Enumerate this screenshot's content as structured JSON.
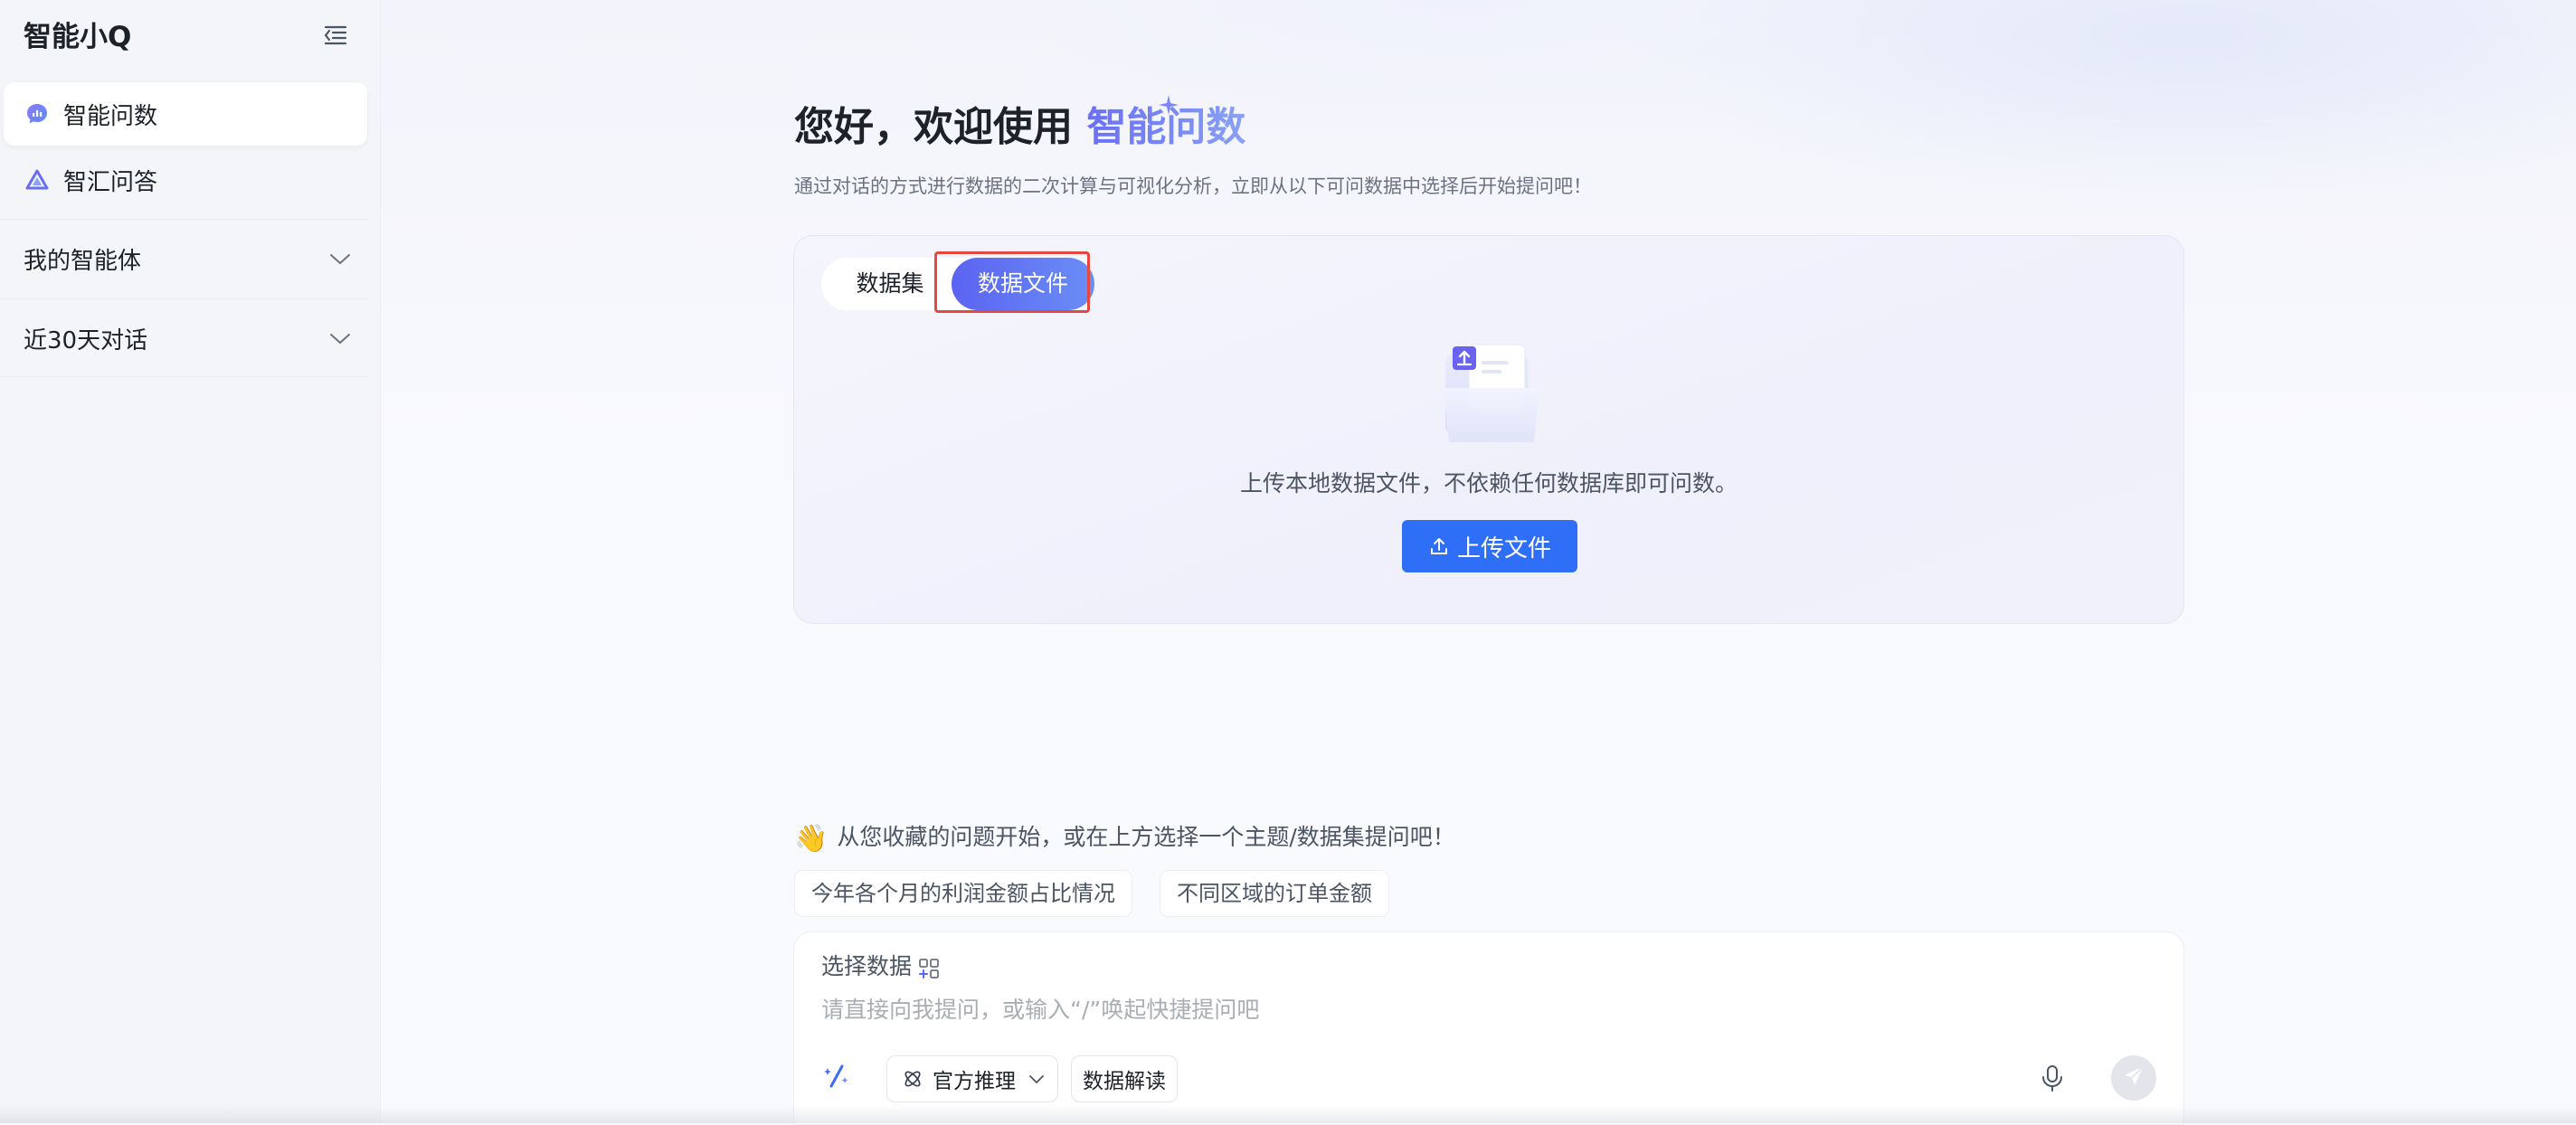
{
  "app": {
    "title": "智能小Q"
  },
  "sidebar": {
    "items": [
      {
        "label": "智能问数",
        "icon": "chat-data-icon",
        "active": true
      },
      {
        "label": "智汇问答",
        "icon": "triangle-logo-icon",
        "active": false
      }
    ],
    "sections": [
      {
        "label": "我的智能体",
        "icon": "chevron-down-icon"
      },
      {
        "label": "近30天对话",
        "icon": "chevron-down-icon"
      }
    ]
  },
  "main": {
    "greeting_prefix": "您好，欢迎使用",
    "greeting_highlight": "智能问数",
    "subtitle": "通过对话的方式进行数据的二次计算与可视化分析，立即从以下可问数据中选择后开始提问吧！",
    "tabs": [
      {
        "label": "数据集",
        "active": false
      },
      {
        "label": "数据文件",
        "active": true
      }
    ],
    "upload": {
      "description": "上传本地数据文件，不依赖任何数据库即可问数。",
      "button_label": "上传文件"
    },
    "hint": {
      "emoji": "👋",
      "text": "从您收藏的问题开始，或在上方选择一个主题/数据集提问吧！"
    },
    "suggestions": [
      "今年各个月的利润金额占比情况",
      "不同区域的订单金额"
    ]
  },
  "composer": {
    "select_data_label": "选择数据",
    "placeholder": "请直接向我提问，或输入“/”唤起快捷提问吧",
    "value": "",
    "model_label": "官方推理",
    "interpret_label": "数据解读"
  },
  "colors": {
    "accent": "#2f6ff8",
    "tab_active_start": "#5b63f2",
    "tab_active_end": "#6a8ef5",
    "highlight_box": "#e5483f"
  }
}
